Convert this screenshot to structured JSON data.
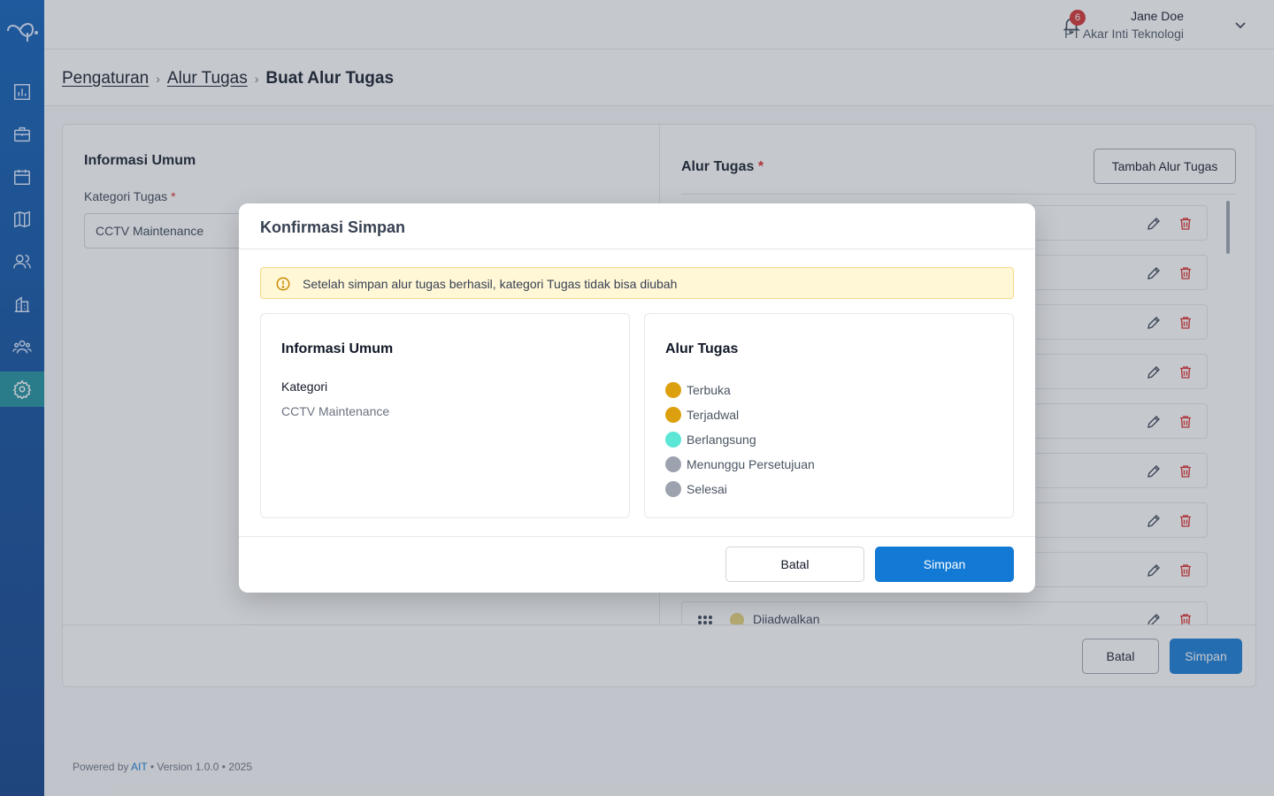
{
  "header": {
    "notification_count": "6",
    "user_name": "Jane Doe",
    "user_org": "PT Akar Inti Teknologi"
  },
  "sidebar": {
    "items": [
      {
        "icon": "bar-chart-icon"
      },
      {
        "icon": "briefcase-icon"
      },
      {
        "icon": "calendar-icon"
      },
      {
        "icon": "map-icon"
      },
      {
        "icon": "users-icon"
      },
      {
        "icon": "building-icon"
      },
      {
        "icon": "group-icon"
      },
      {
        "icon": "gear-icon",
        "active": true
      }
    ]
  },
  "breadcrumb": {
    "items": [
      "Pengaturan",
      "Alur Tugas"
    ],
    "current": "Buat Alur Tugas"
  },
  "form": {
    "section_title": "Informasi Umum",
    "category_label": "Kategori Tugas",
    "required_mark": "*",
    "category_value": "CCTV Maintenance"
  },
  "flow_panel": {
    "title": "Alur Tugas",
    "add_button": "Tambah Alur Tugas",
    "visible_row_label": "Diiadwalkan",
    "visible_row_color": "#e8d27a"
  },
  "footer_actions": {
    "cancel": "Batal",
    "save": "Simpan"
  },
  "footer": {
    "prefix": "Powered by",
    "brand": "AIT",
    "suffix": "• Version 1.0.0 • 2025"
  },
  "modal": {
    "title": "Konfirmasi Simpan",
    "alert": "Setelah simpan alur tugas berhasil, kategori Tugas tidak bisa diubah",
    "general_title": "Informasi Umum",
    "category_label": "Kategori",
    "category_value": "CCTV Maintenance",
    "flow_title": "Alur Tugas",
    "flow": [
      {
        "label": "Terbuka",
        "color": "#dca00e"
      },
      {
        "label": "Terjadwal",
        "color": "#dca00e"
      },
      {
        "label": "Berlangsung",
        "color": "#5ce6d6"
      },
      {
        "label": "Menunggu Persetujuan",
        "color": "#9ca3af"
      },
      {
        "label": "Selesai",
        "color": "#9ca3af"
      }
    ],
    "cancel": "Batal",
    "save": "Simpan"
  },
  "colors": {
    "primary": "#1279d4",
    "sidebar": "#0b4a9a",
    "active_nav": "#1d8f9e",
    "danger": "#dc2626"
  }
}
